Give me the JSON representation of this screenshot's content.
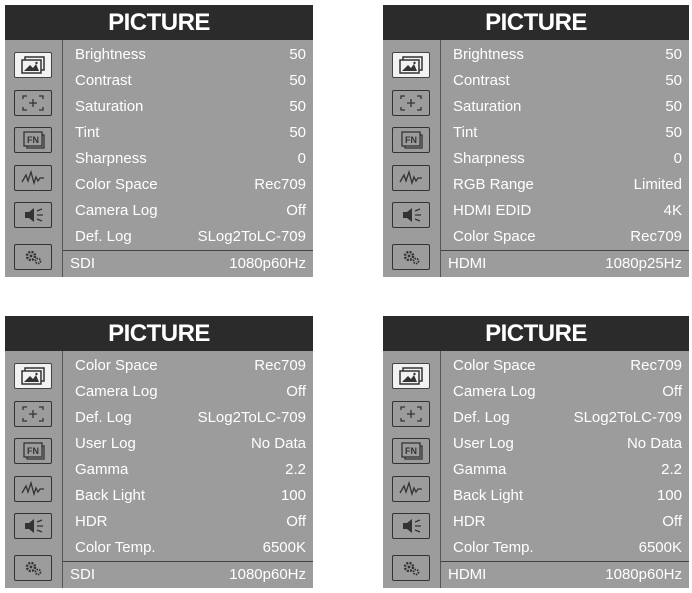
{
  "panels": [
    {
      "title": "PICTURE",
      "rows": [
        {
          "label": "Brightness",
          "value": "50"
        },
        {
          "label": "Contrast",
          "value": "50"
        },
        {
          "label": "Saturation",
          "value": "50"
        },
        {
          "label": "Tint",
          "value": "50"
        },
        {
          "label": "Sharpness",
          "value": "0"
        },
        {
          "label": "Color Space",
          "value": "Rec709"
        },
        {
          "label": "Camera Log",
          "value": "Off"
        },
        {
          "label": "Def. Log",
          "value": "SLog2ToLC-709"
        }
      ],
      "status": {
        "source": "SDI",
        "format": "1080p60Hz"
      }
    },
    {
      "title": "PICTURE",
      "rows": [
        {
          "label": "Brightness",
          "value": "50"
        },
        {
          "label": "Contrast",
          "value": "50"
        },
        {
          "label": "Saturation",
          "value": "50"
        },
        {
          "label": "Tint",
          "value": "50"
        },
        {
          "label": "Sharpness",
          "value": "0"
        },
        {
          "label": "RGB Range",
          "value": "Limited"
        },
        {
          "label": "HDMI EDID",
          "value": "4K"
        },
        {
          "label": "Color Space",
          "value": "Rec709"
        }
      ],
      "status": {
        "source": "HDMI",
        "format": "1080p25Hz"
      }
    },
    {
      "title": "PICTURE",
      "rows": [
        {
          "label": "Color Space",
          "value": "Rec709"
        },
        {
          "label": "Camera Log",
          "value": "Off"
        },
        {
          "label": "Def. Log",
          "value": "SLog2ToLC-709"
        },
        {
          "label": "User Log",
          "value": "No Data"
        },
        {
          "label": "Gamma",
          "value": "2.2"
        },
        {
          "label": "Back Light",
          "value": "100"
        },
        {
          "label": "HDR",
          "value": "Off"
        },
        {
          "label": "Color Temp.",
          "value": "6500K"
        }
      ],
      "status": {
        "source": "SDI",
        "format": "1080p60Hz"
      }
    },
    {
      "title": "PICTURE",
      "rows": [
        {
          "label": "Color Space",
          "value": "Rec709"
        },
        {
          "label": "Camera Log",
          "value": "Off"
        },
        {
          "label": "Def. Log",
          "value": "SLog2ToLC-709"
        },
        {
          "label": "User Log",
          "value": "No Data"
        },
        {
          "label": "Gamma",
          "value": "2.2"
        },
        {
          "label": "Back Light",
          "value": "100"
        },
        {
          "label": "HDR",
          "value": "Off"
        },
        {
          "label": "Color Temp.",
          "value": "6500K"
        }
      ],
      "status": {
        "source": "HDMI",
        "format": "1080p60Hz"
      }
    }
  ],
  "sidebar_icons": [
    "picture-icon",
    "marker-icon",
    "function-key-icon",
    "audio-waveform-icon",
    "speaker-icon",
    "settings-icon"
  ],
  "colors": {
    "panel_bg": "#9c9c9c",
    "title_bg": "#2b2b2b",
    "text": "#ffffff",
    "selected_icon_bg": "#f2f2f2"
  }
}
